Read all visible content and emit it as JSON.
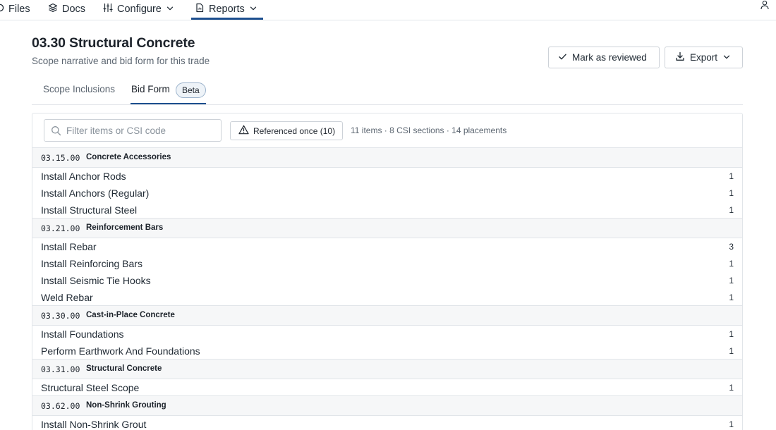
{
  "nav": {
    "items": [
      {
        "label": "Files",
        "icon": "folder-icon"
      },
      {
        "label": "Docs",
        "icon": "layers-icon"
      },
      {
        "label": "Configure",
        "icon": "sliders-icon"
      },
      {
        "label": "Reports",
        "icon": "report-icon"
      }
    ],
    "active": "Reports"
  },
  "header": {
    "title": "03.30 Structural Concrete",
    "subtitle": "Scope narrative and bid form for this trade",
    "review_label": "Mark as reviewed",
    "export_label": "Export"
  },
  "tabs": [
    {
      "label": "Scope Inclusions"
    },
    {
      "label": "Bid Form",
      "badge": "Beta"
    }
  ],
  "toolbar": {
    "search_placeholder": "Filter items or CSI code",
    "filter_label": "Referenced once (10)",
    "stats": "11 items · 8 CSI sections · 14 placements"
  },
  "sections": [
    {
      "code": "03.15.00",
      "title": "Concrete Accessories",
      "items": [
        {
          "name": "Install Anchor Rods",
          "count": "1"
        },
        {
          "name": "Install Anchors (Regular)",
          "count": "1"
        },
        {
          "name": "Install Structural Steel",
          "count": "1"
        }
      ]
    },
    {
      "code": "03.21.00",
      "title": "Reinforcement Bars",
      "items": [
        {
          "name": "Install Rebar",
          "count": "3"
        },
        {
          "name": "Install Reinforcing Bars",
          "count": "1"
        },
        {
          "name": "Install Seismic Tie Hooks",
          "count": "1"
        },
        {
          "name": "Weld Rebar",
          "count": "1"
        }
      ]
    },
    {
      "code": "03.30.00",
      "title": "Cast-in-Place Concrete",
      "items": [
        {
          "name": "Install Foundations",
          "count": "1"
        },
        {
          "name": "Perform Earthwork And Foundations",
          "count": "1"
        }
      ]
    },
    {
      "code": "03.31.00",
      "title": "Structural Concrete",
      "items": [
        {
          "name": "Structural Steel Scope",
          "count": "1"
        }
      ]
    },
    {
      "code": "03.62.00",
      "title": "Non-Shrink Grouting",
      "items": [
        {
          "name": "Install Non-Shrink Grout",
          "count": "1"
        }
      ]
    }
  ]
}
